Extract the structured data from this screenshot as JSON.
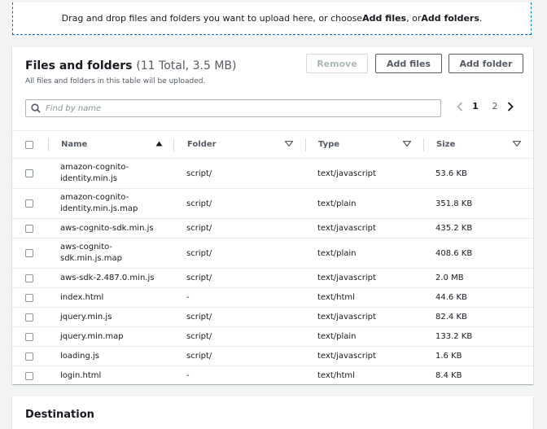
{
  "dropzone": {
    "text_pre": "Drag and drop files and folders you want to upload here, or choose ",
    "add_files": "Add files",
    "text_mid": ", or ",
    "add_folders": "Add folders",
    "text_post": "."
  },
  "files_panel": {
    "title": "Files and folders",
    "count": "(11 Total, 3.5 MB)",
    "description": "All files and folders in this table will be uploaded.",
    "remove_label": "Remove",
    "add_files_label": "Add files",
    "add_folder_label": "Add folder",
    "search_placeholder": "Find by name",
    "pages": [
      "1",
      "2"
    ],
    "current_page": "1"
  },
  "table": {
    "headers": [
      "Name",
      "Folder",
      "Type",
      "Size"
    ],
    "rows": [
      {
        "name": "amazon-cognito-identity.min.js",
        "name_lines": [
          "amazon-cognito-",
          "identity.min.js"
        ],
        "folder": "script/",
        "type": "text/javascript",
        "size": "53.6 KB"
      },
      {
        "name": "amazon-cognito-identity.min.js.map",
        "name_lines": [
          "amazon-cognito-",
          "identity.min.js.map"
        ],
        "folder": "script/",
        "type": "text/plain",
        "size": "351.8 KB"
      },
      {
        "name": "aws-cognito-sdk.min.js",
        "name_lines": [
          "aws-cognito-sdk.min.js"
        ],
        "folder": "script/",
        "type": "text/javascript",
        "size": "435.2 KB"
      },
      {
        "name": "aws-cognito-sdk.min.js.map",
        "name_lines": [
          "aws-cognito-",
          "sdk.min.js.map"
        ],
        "folder": "script/",
        "type": "text/plain",
        "size": "408.6 KB"
      },
      {
        "name": "aws-sdk-2.487.0.min.js",
        "name_lines": [
          "aws-sdk-2.487.0.min.js"
        ],
        "folder": "script/",
        "type": "text/javascript",
        "size": "2.0 MB"
      },
      {
        "name": "index.html",
        "name_lines": [
          "index.html"
        ],
        "folder": "-",
        "type": "text/html",
        "size": "44.6 KB"
      },
      {
        "name": "jquery.min.js",
        "name_lines": [
          "jquery.min.js"
        ],
        "folder": "script/",
        "type": "text/javascript",
        "size": "82.4 KB"
      },
      {
        "name": "jquery.min.map",
        "name_lines": [
          "jquery.min.map"
        ],
        "folder": "script/",
        "type": "text/plain",
        "size": "133.2 KB"
      },
      {
        "name": "loading.js",
        "name_lines": [
          "loading.js"
        ],
        "folder": "script/",
        "type": "text/javascript",
        "size": "1.6 KB"
      },
      {
        "name": "login.html",
        "name_lines": [
          "login.html"
        ],
        "folder": "-",
        "type": "text/html",
        "size": "8.4 KB"
      }
    ]
  },
  "destination": {
    "title": "Destination"
  },
  "colors": {
    "accent": "#0073bb",
    "border": "#eaeded",
    "muted": "#545b64"
  },
  "icons": {
    "search": "search-icon",
    "sort_ascending": "caret-up-icon",
    "filter": "caret-down-icon",
    "prev": "chevron-left-icon",
    "next": "chevron-right-icon"
  }
}
